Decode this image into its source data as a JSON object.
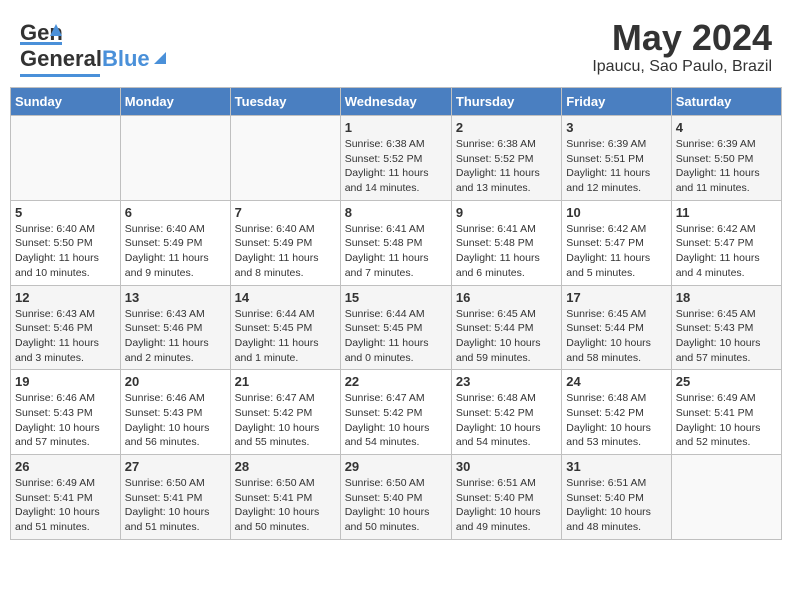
{
  "header": {
    "logo_general": "General",
    "logo_blue": "Blue",
    "title": "May 2024",
    "subtitle": "Ipaucu, Sao Paulo, Brazil"
  },
  "weekdays": [
    "Sunday",
    "Monday",
    "Tuesday",
    "Wednesday",
    "Thursday",
    "Friday",
    "Saturday"
  ],
  "weeks": [
    [
      {
        "day": "",
        "info": ""
      },
      {
        "day": "",
        "info": ""
      },
      {
        "day": "",
        "info": ""
      },
      {
        "day": "1",
        "info": "Sunrise: 6:38 AM\nSunset: 5:52 PM\nDaylight: 11 hours and 14 minutes."
      },
      {
        "day": "2",
        "info": "Sunrise: 6:38 AM\nSunset: 5:52 PM\nDaylight: 11 hours and 13 minutes."
      },
      {
        "day": "3",
        "info": "Sunrise: 6:39 AM\nSunset: 5:51 PM\nDaylight: 11 hours and 12 minutes."
      },
      {
        "day": "4",
        "info": "Sunrise: 6:39 AM\nSunset: 5:50 PM\nDaylight: 11 hours and 11 minutes."
      }
    ],
    [
      {
        "day": "5",
        "info": "Sunrise: 6:40 AM\nSunset: 5:50 PM\nDaylight: 11 hours and 10 minutes."
      },
      {
        "day": "6",
        "info": "Sunrise: 6:40 AM\nSunset: 5:49 PM\nDaylight: 11 hours and 9 minutes."
      },
      {
        "day": "7",
        "info": "Sunrise: 6:40 AM\nSunset: 5:49 PM\nDaylight: 11 hours and 8 minutes."
      },
      {
        "day": "8",
        "info": "Sunrise: 6:41 AM\nSunset: 5:48 PM\nDaylight: 11 hours and 7 minutes."
      },
      {
        "day": "9",
        "info": "Sunrise: 6:41 AM\nSunset: 5:48 PM\nDaylight: 11 hours and 6 minutes."
      },
      {
        "day": "10",
        "info": "Sunrise: 6:42 AM\nSunset: 5:47 PM\nDaylight: 11 hours and 5 minutes."
      },
      {
        "day": "11",
        "info": "Sunrise: 6:42 AM\nSunset: 5:47 PM\nDaylight: 11 hours and 4 minutes."
      }
    ],
    [
      {
        "day": "12",
        "info": "Sunrise: 6:43 AM\nSunset: 5:46 PM\nDaylight: 11 hours and 3 minutes."
      },
      {
        "day": "13",
        "info": "Sunrise: 6:43 AM\nSunset: 5:46 PM\nDaylight: 11 hours and 2 minutes."
      },
      {
        "day": "14",
        "info": "Sunrise: 6:44 AM\nSunset: 5:45 PM\nDaylight: 11 hours and 1 minute."
      },
      {
        "day": "15",
        "info": "Sunrise: 6:44 AM\nSunset: 5:45 PM\nDaylight: 11 hours and 0 minutes."
      },
      {
        "day": "16",
        "info": "Sunrise: 6:45 AM\nSunset: 5:44 PM\nDaylight: 10 hours and 59 minutes."
      },
      {
        "day": "17",
        "info": "Sunrise: 6:45 AM\nSunset: 5:44 PM\nDaylight: 10 hours and 58 minutes."
      },
      {
        "day": "18",
        "info": "Sunrise: 6:45 AM\nSunset: 5:43 PM\nDaylight: 10 hours and 57 minutes."
      }
    ],
    [
      {
        "day": "19",
        "info": "Sunrise: 6:46 AM\nSunset: 5:43 PM\nDaylight: 10 hours and 57 minutes."
      },
      {
        "day": "20",
        "info": "Sunrise: 6:46 AM\nSunset: 5:43 PM\nDaylight: 10 hours and 56 minutes."
      },
      {
        "day": "21",
        "info": "Sunrise: 6:47 AM\nSunset: 5:42 PM\nDaylight: 10 hours and 55 minutes."
      },
      {
        "day": "22",
        "info": "Sunrise: 6:47 AM\nSunset: 5:42 PM\nDaylight: 10 hours and 54 minutes."
      },
      {
        "day": "23",
        "info": "Sunrise: 6:48 AM\nSunset: 5:42 PM\nDaylight: 10 hours and 54 minutes."
      },
      {
        "day": "24",
        "info": "Sunrise: 6:48 AM\nSunset: 5:42 PM\nDaylight: 10 hours and 53 minutes."
      },
      {
        "day": "25",
        "info": "Sunrise: 6:49 AM\nSunset: 5:41 PM\nDaylight: 10 hours and 52 minutes."
      }
    ],
    [
      {
        "day": "26",
        "info": "Sunrise: 6:49 AM\nSunset: 5:41 PM\nDaylight: 10 hours and 51 minutes."
      },
      {
        "day": "27",
        "info": "Sunrise: 6:50 AM\nSunset: 5:41 PM\nDaylight: 10 hours and 51 minutes."
      },
      {
        "day": "28",
        "info": "Sunrise: 6:50 AM\nSunset: 5:41 PM\nDaylight: 10 hours and 50 minutes."
      },
      {
        "day": "29",
        "info": "Sunrise: 6:50 AM\nSunset: 5:40 PM\nDaylight: 10 hours and 50 minutes."
      },
      {
        "day": "30",
        "info": "Sunrise: 6:51 AM\nSunset: 5:40 PM\nDaylight: 10 hours and 49 minutes."
      },
      {
        "day": "31",
        "info": "Sunrise: 6:51 AM\nSunset: 5:40 PM\nDaylight: 10 hours and 48 minutes."
      },
      {
        "day": "",
        "info": ""
      }
    ]
  ]
}
